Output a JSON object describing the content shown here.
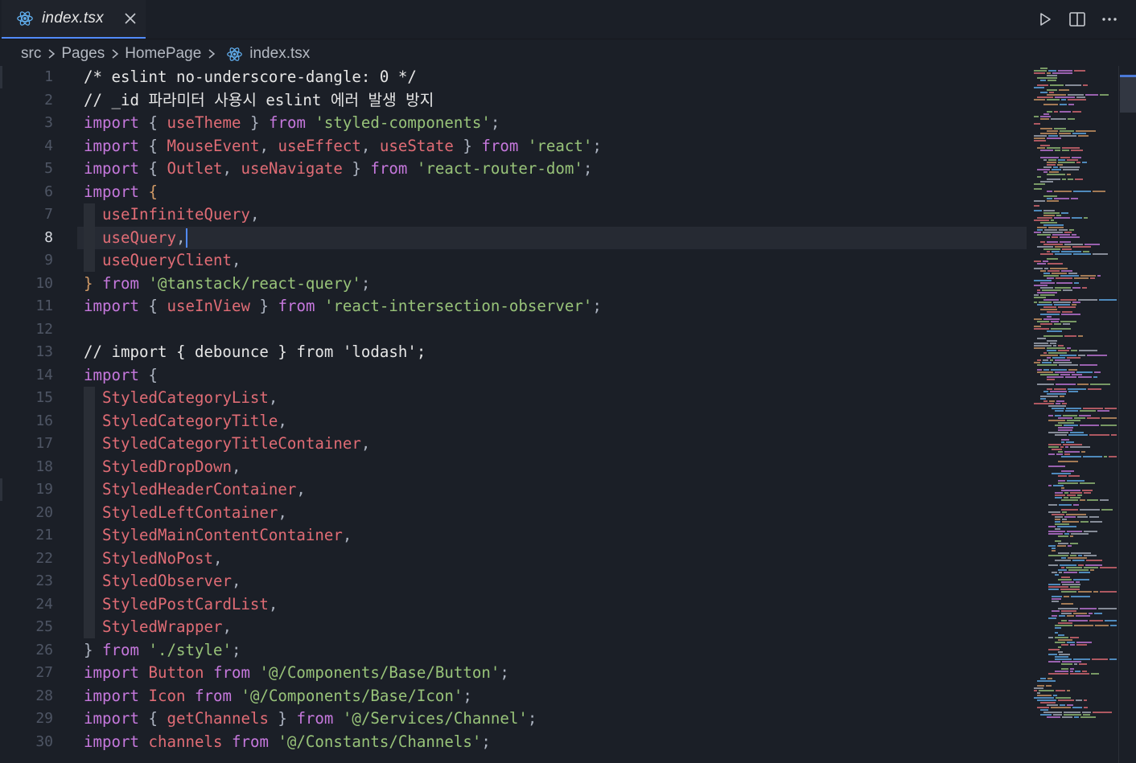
{
  "tab": {
    "label": "index.tsx",
    "icon": "react-icon",
    "close_icon": "close-icon"
  },
  "actions": [
    {
      "name": "run-icon",
      "title": "Run"
    },
    {
      "name": "split-editor-icon",
      "title": "Split Editor"
    },
    {
      "name": "more-actions-icon",
      "title": "More Actions"
    }
  ],
  "breadcrumb": {
    "items": [
      "src",
      "Pages",
      "HomePage",
      "index.tsx"
    ]
  },
  "editor": {
    "active_line": 8,
    "line_numbers": [
      "1",
      "2",
      "3",
      "4",
      "5",
      "6",
      "7",
      "8",
      "9",
      "10",
      "11",
      "12",
      "13",
      "14",
      "15",
      "16",
      "17",
      "18",
      "19",
      "20",
      "21",
      "22",
      "23",
      "24",
      "25",
      "26",
      "27",
      "28",
      "29",
      "30"
    ],
    "lines": [
      [
        [
          "c",
          "/* eslint no-underscore-dangle: 0 */"
        ]
      ],
      [
        [
          "c",
          "// _id 파라미터 사용시 eslint 에러 발생 방지"
        ]
      ],
      [
        [
          "k",
          "import"
        ],
        [
          "p",
          " { "
        ],
        [
          "i",
          "useTheme"
        ],
        [
          "p",
          " } "
        ],
        [
          "k",
          "from"
        ],
        [
          "p",
          " "
        ],
        [
          "s",
          "'styled-components'"
        ],
        [
          "p",
          ";"
        ]
      ],
      [
        [
          "k",
          "import"
        ],
        [
          "p",
          " { "
        ],
        [
          "i",
          "MouseEvent"
        ],
        [
          "p",
          ", "
        ],
        [
          "i",
          "useEffect"
        ],
        [
          "p",
          ", "
        ],
        [
          "i",
          "useState"
        ],
        [
          "p",
          " } "
        ],
        [
          "k",
          "from"
        ],
        [
          "p",
          " "
        ],
        [
          "s",
          "'react'"
        ],
        [
          "p",
          ";"
        ]
      ],
      [
        [
          "k",
          "import"
        ],
        [
          "p",
          " { "
        ],
        [
          "i",
          "Outlet"
        ],
        [
          "p",
          ", "
        ],
        [
          "i",
          "useNavigate"
        ],
        [
          "p",
          " } "
        ],
        [
          "k",
          "from"
        ],
        [
          "p",
          " "
        ],
        [
          "s",
          "'react-router-dom'"
        ],
        [
          "p",
          ";"
        ]
      ],
      [
        [
          "k",
          "import"
        ],
        [
          "p",
          " "
        ],
        [
          "br",
          "{"
        ]
      ],
      [
        [
          "p",
          "  "
        ],
        [
          "i",
          "useInfiniteQuery"
        ],
        [
          "p",
          ","
        ]
      ],
      [
        [
          "p",
          "  "
        ],
        [
          "i",
          "useQuery"
        ],
        [
          "p",
          ","
        ]
      ],
      [
        [
          "p",
          "  "
        ],
        [
          "i",
          "useQueryClient"
        ],
        [
          "p",
          ","
        ]
      ],
      [
        [
          "br",
          "}"
        ],
        [
          "p",
          " "
        ],
        [
          "k",
          "from"
        ],
        [
          "p",
          " "
        ],
        [
          "s",
          "'@tanstack/react-query'"
        ],
        [
          "p",
          ";"
        ]
      ],
      [
        [
          "k",
          "import"
        ],
        [
          "p",
          " { "
        ],
        [
          "i",
          "useInView"
        ],
        [
          "p",
          " } "
        ],
        [
          "k",
          "from"
        ],
        [
          "p",
          " "
        ],
        [
          "s",
          "'react-intersection-observer'"
        ],
        [
          "p",
          ";"
        ]
      ],
      [],
      [
        [
          "c",
          "// import { debounce } from 'lodash';"
        ]
      ],
      [
        [
          "k",
          "import"
        ],
        [
          "p",
          " {"
        ]
      ],
      [
        [
          "p",
          "  "
        ],
        [
          "i",
          "StyledCategoryList"
        ],
        [
          "p",
          ","
        ]
      ],
      [
        [
          "p",
          "  "
        ],
        [
          "i",
          "StyledCategoryTitle"
        ],
        [
          "p",
          ","
        ]
      ],
      [
        [
          "p",
          "  "
        ],
        [
          "i",
          "StyledCategoryTitleContainer"
        ],
        [
          "p",
          ","
        ]
      ],
      [
        [
          "p",
          "  "
        ],
        [
          "i",
          "StyledDropDown"
        ],
        [
          "p",
          ","
        ]
      ],
      [
        [
          "p",
          "  "
        ],
        [
          "i",
          "StyledHeaderContainer"
        ],
        [
          "p",
          ","
        ]
      ],
      [
        [
          "p",
          "  "
        ],
        [
          "i",
          "StyledLeftContainer"
        ],
        [
          "p",
          ","
        ]
      ],
      [
        [
          "p",
          "  "
        ],
        [
          "i",
          "StyledMainContentContainer"
        ],
        [
          "p",
          ","
        ]
      ],
      [
        [
          "p",
          "  "
        ],
        [
          "i",
          "StyledNoPost"
        ],
        [
          "p",
          ","
        ]
      ],
      [
        [
          "p",
          "  "
        ],
        [
          "i",
          "StyledObserver"
        ],
        [
          "p",
          ","
        ]
      ],
      [
        [
          "p",
          "  "
        ],
        [
          "i",
          "StyledPostCardList"
        ],
        [
          "p",
          ","
        ]
      ],
      [
        [
          "p",
          "  "
        ],
        [
          "i",
          "StyledWrapper"
        ],
        [
          "p",
          ","
        ]
      ],
      [
        [
          "p",
          "} "
        ],
        [
          "k",
          "from"
        ],
        [
          "p",
          " "
        ],
        [
          "s",
          "'./style'"
        ],
        [
          "p",
          ";"
        ]
      ],
      [
        [
          "k",
          "import"
        ],
        [
          "p",
          " "
        ],
        [
          "i",
          "Button"
        ],
        [
          "p",
          " "
        ],
        [
          "k",
          "from"
        ],
        [
          "p",
          " "
        ],
        [
          "s",
          "'@/Components/Base/Button'"
        ],
        [
          "p",
          ";"
        ]
      ],
      [
        [
          "k",
          "import"
        ],
        [
          "p",
          " "
        ],
        [
          "i",
          "Icon"
        ],
        [
          "p",
          " "
        ],
        [
          "k",
          "from"
        ],
        [
          "p",
          " "
        ],
        [
          "s",
          "'@/Components/Base/Icon'"
        ],
        [
          "p",
          ";"
        ]
      ],
      [
        [
          "k",
          "import"
        ],
        [
          "p",
          " { "
        ],
        [
          "i",
          "getChannels"
        ],
        [
          "p",
          " } "
        ],
        [
          "k",
          "from"
        ],
        [
          "p",
          " "
        ],
        [
          "s",
          "'@/Services/Channel'"
        ],
        [
          "p",
          ";"
        ]
      ],
      [
        [
          "k",
          "import"
        ],
        [
          "p",
          " "
        ],
        [
          "i",
          "channels"
        ],
        [
          "p",
          " "
        ],
        [
          "k",
          "from"
        ],
        [
          "p",
          " "
        ],
        [
          "s",
          "'@/Constants/Channels'"
        ],
        [
          "p",
          ";"
        ]
      ]
    ]
  },
  "colors": {
    "background": "#1b1f27",
    "keyword": "#c678dd",
    "string": "#98c379",
    "identifier": "#e06c75",
    "comment": "#e6e6e6",
    "accent": "#528bff"
  }
}
